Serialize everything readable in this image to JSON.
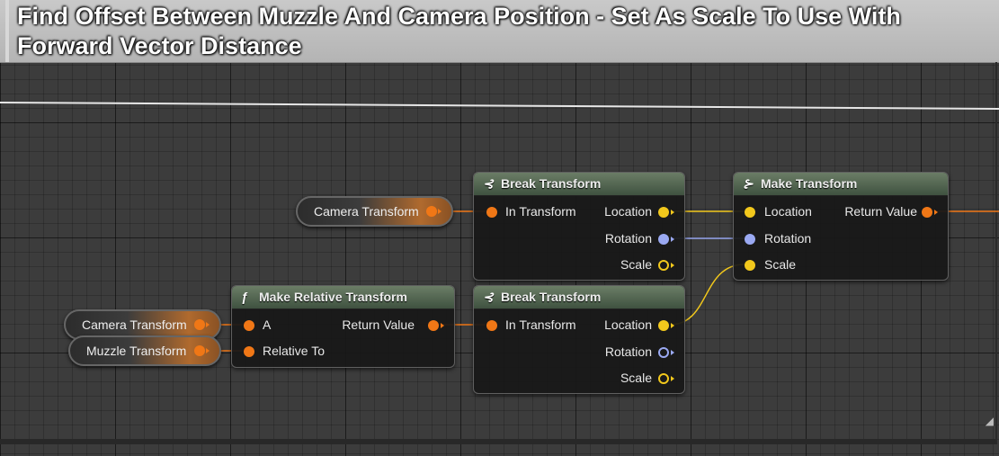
{
  "comment": {
    "title": "Find Offset Between Muzzle And Camera Position - Set As Scale To Use With Forward Vector Distance"
  },
  "colors": {
    "transform_pin": "#f07716",
    "vector_pin": "#f2c81c",
    "rotator_pin": "#9aa9f2",
    "node_header": "#4f6a4a",
    "comment_bar": "#c0c0c0"
  },
  "variables": {
    "camera_transform_top": "Camera Transform",
    "camera_transform_bottom": "Camera Transform",
    "muzzle_transform": "Muzzle Transform"
  },
  "nodes": {
    "break_transform_top": {
      "title": "Break Transform",
      "icon": "break-struct-icon",
      "input": "In Transform",
      "outputs": [
        "Location",
        "Rotation",
        "Scale"
      ]
    },
    "make_transform": {
      "title": "Make Transform",
      "icon": "make-struct-icon",
      "inputs": [
        "Location",
        "Rotation",
        "Scale"
      ],
      "output": "Return Value"
    },
    "make_relative_transform": {
      "title": "Make Relative Transform",
      "icon": "function-icon",
      "inputs": [
        "A",
        "Relative To"
      ],
      "output": "Return Value"
    },
    "break_transform_bottom": {
      "title": "Break Transform",
      "icon": "break-struct-icon",
      "input": "In Transform",
      "outputs": [
        "Location",
        "Rotation",
        "Scale"
      ]
    }
  }
}
